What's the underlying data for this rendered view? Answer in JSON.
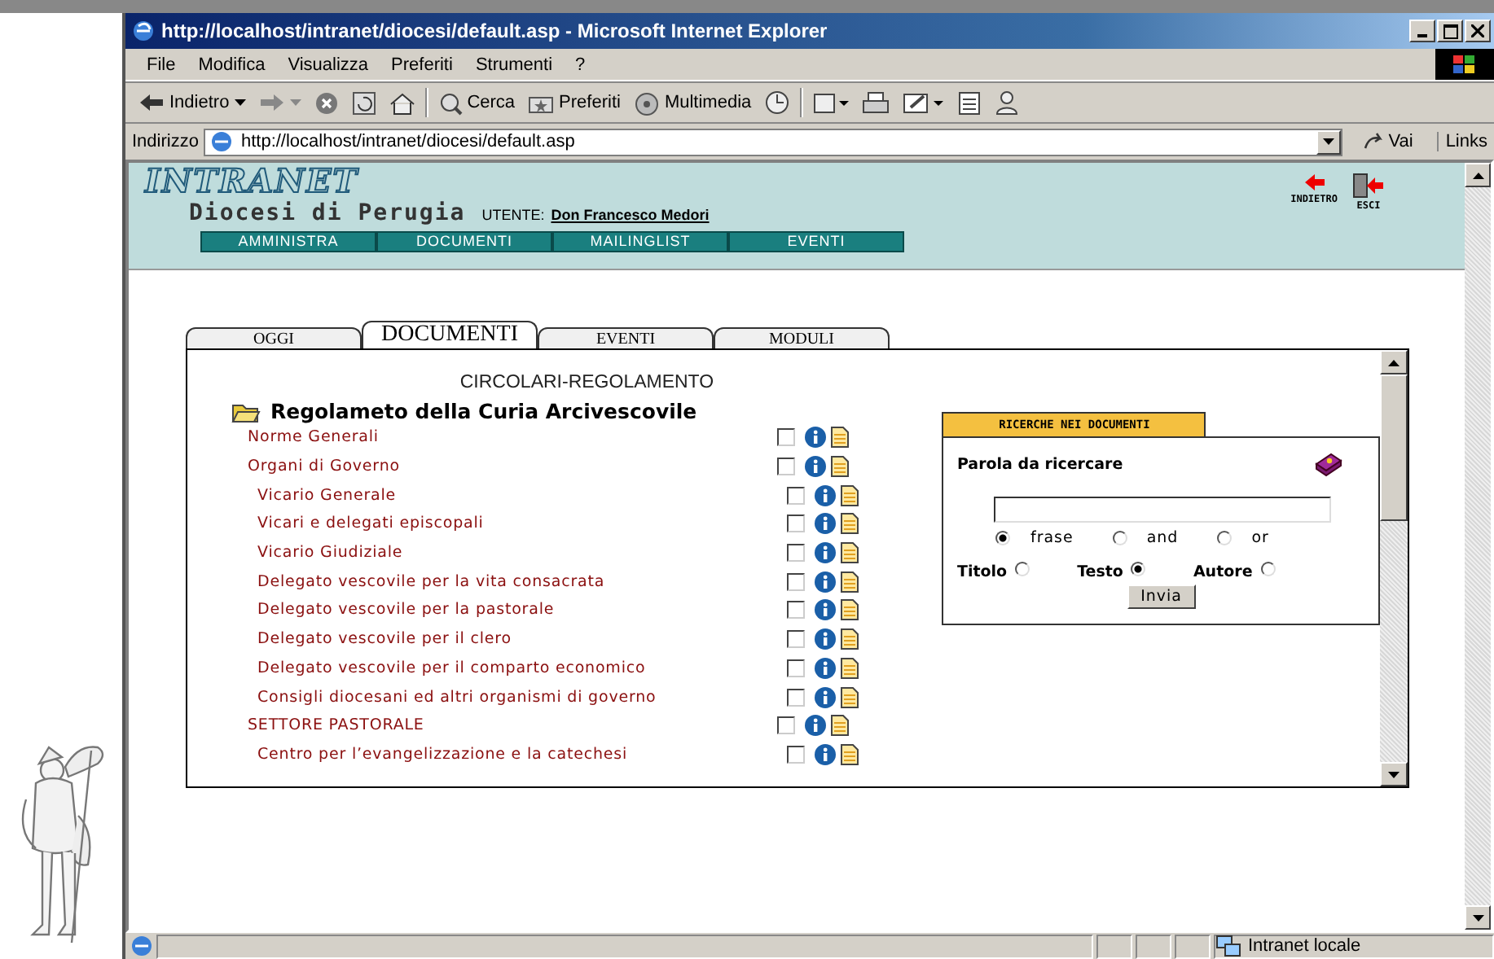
{
  "window": {
    "title": "http://localhost/intranet/diocesi/default.asp - Microsoft Internet Explorer"
  },
  "menu": [
    "File",
    "Modifica",
    "Visualizza",
    "Preferiti",
    "Strumenti",
    "?"
  ],
  "toolbar": [
    {
      "kind": "back",
      "label": "Indietro"
    },
    {
      "kind": "forward"
    },
    {
      "kind": "stop"
    },
    {
      "kind": "refresh"
    },
    {
      "kind": "home"
    },
    {
      "kind": "search",
      "label": "Cerca"
    },
    {
      "kind": "favorites",
      "label": "Preferiti"
    },
    {
      "kind": "media",
      "label": "Multimedia"
    },
    {
      "kind": "history"
    },
    {
      "kind": "mail"
    },
    {
      "kind": "print"
    },
    {
      "kind": "edit"
    },
    {
      "kind": "discuss"
    },
    {
      "kind": "messenger"
    }
  ],
  "address": {
    "label": "Indirizzo",
    "value": "http://localhost/intranet/diocesi/default.asp",
    "go": "Vai",
    "links": "Links"
  },
  "header": {
    "logo": "INTRANET",
    "subtitle": "Diocesi di Perugia",
    "user_label": "UTENTE:",
    "user": "Don Francesco Medori",
    "actions": [
      {
        "kind": "back",
        "label": "INDIETRO"
      },
      {
        "kind": "exit",
        "label": "ESCI"
      }
    ],
    "nav": [
      "AMMINISTRA",
      "DOCUMENTI",
      "MAILINGLIST",
      "EVENTI"
    ]
  },
  "tabs": [
    {
      "label": "OGGI",
      "selected": false
    },
    {
      "label": "DOCUMENTI",
      "selected": true
    },
    {
      "label": "EVENTI",
      "selected": false
    },
    {
      "label": "MODULI",
      "selected": false
    }
  ],
  "documents": {
    "section": "CIRCOLARI-REGOLAMENTO",
    "folder": "Regolameto della Curia Arcivescovile",
    "items": [
      {
        "label": "Norme Generali",
        "checked": false
      },
      {
        "label": "Organi di Governo",
        "checked": false,
        "children": [
          {
            "label": "Vicario Generale",
            "checked": false
          },
          {
            "label": "Vicari e delegati episcopali",
            "checked": false
          },
          {
            "label": "Vicario Giudiziale",
            "checked": false
          },
          {
            "label": "Delegato vescovile per la vita consacrata",
            "checked": false
          },
          {
            "label": "Delegato vescovile per la pastorale",
            "checked": false
          },
          {
            "label": "Delegato vescovile per il clero",
            "checked": false
          },
          {
            "label": "Delegato vescovile per il comparto economico",
            "checked": false
          },
          {
            "label": "Consigli diocesani ed altri organismi di governo",
            "checked": false
          }
        ]
      },
      {
        "label": "SETTORE PASTORALE",
        "checked": false,
        "children": [
          {
            "label": "Centro per l’evangelizzazione e la catechesi",
            "checked": false
          }
        ]
      }
    ]
  },
  "search": {
    "tab": "RICERCHE NEI DOCUMENTI",
    "label": "Parola da ricercare",
    "modes": [
      {
        "label": "frase",
        "selected": true
      },
      {
        "label": "and",
        "selected": false
      },
      {
        "label": "or",
        "selected": false
      }
    ],
    "fields": [
      {
        "label": "Titolo",
        "selected": false
      },
      {
        "label": "Testo",
        "selected": true
      },
      {
        "label": "Autore",
        "selected": false
      }
    ],
    "submit": "Invia"
  },
  "status_bar": {
    "zone": "Intranet locale"
  }
}
